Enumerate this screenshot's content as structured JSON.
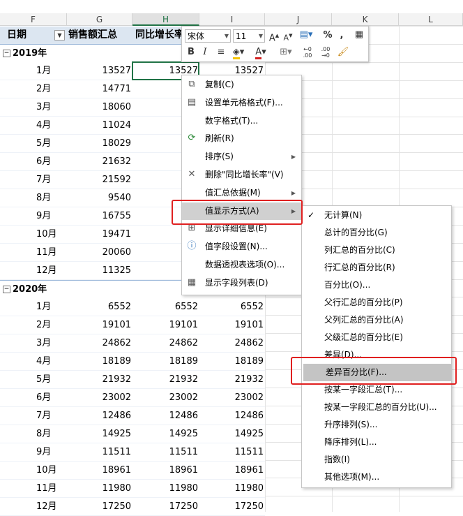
{
  "columns": [
    "F",
    "G",
    "H",
    "I",
    "J",
    "K",
    "L"
  ],
  "header": {
    "date": "日期",
    "sales": "销售额汇总",
    "growth": "同比增长率"
  },
  "years": [
    {
      "label": "2019年",
      "rows": [
        {
          "m": "1月",
          "g": "13527",
          "h": "13527",
          "i": "13527"
        },
        {
          "m": "2月",
          "g": "14771",
          "h": "14",
          "i": ""
        },
        {
          "m": "3月",
          "g": "18060",
          "h": "18",
          "i": ""
        },
        {
          "m": "4月",
          "g": "11024",
          "h": "11",
          "i": ""
        },
        {
          "m": "5月",
          "g": "18029",
          "h": "18",
          "i": ""
        },
        {
          "m": "6月",
          "g": "21632",
          "h": "21",
          "i": ""
        },
        {
          "m": "7月",
          "g": "21592",
          "h": "21",
          "i": ""
        },
        {
          "m": "8月",
          "g": "9540",
          "h": "9",
          "i": ""
        },
        {
          "m": "9月",
          "g": "16755",
          "h": "16",
          "i": ""
        },
        {
          "m": "10月",
          "g": "19471",
          "h": "19",
          "i": ""
        },
        {
          "m": "11月",
          "g": "20060",
          "h": "20",
          "i": ""
        },
        {
          "m": "12月",
          "g": "11325",
          "h": "11",
          "i": ""
        }
      ]
    },
    {
      "label": "2020年",
      "rows": [
        {
          "m": "1月",
          "g": "6552",
          "h": "6552",
          "i": "6552"
        },
        {
          "m": "2月",
          "g": "19101",
          "h": "19101",
          "i": "19101"
        },
        {
          "m": "3月",
          "g": "24862",
          "h": "24862",
          "i": "24862"
        },
        {
          "m": "4月",
          "g": "18189",
          "h": "18189",
          "i": "18189"
        },
        {
          "m": "5月",
          "g": "21932",
          "h": "21932",
          "i": "21932"
        },
        {
          "m": "6月",
          "g": "23002",
          "h": "23002",
          "i": "23002"
        },
        {
          "m": "7月",
          "g": "12486",
          "h": "12486",
          "i": "12486"
        },
        {
          "m": "8月",
          "g": "14925",
          "h": "14925",
          "i": "14925"
        },
        {
          "m": "9月",
          "g": "11511",
          "h": "11511",
          "i": "11511"
        },
        {
          "m": "10月",
          "g": "18961",
          "h": "18961",
          "i": "18961"
        },
        {
          "m": "11月",
          "g": "11980",
          "h": "11980",
          "i": "11980"
        },
        {
          "m": "12月",
          "g": "17250",
          "h": "17250",
          "i": "17250"
        }
      ]
    }
  ],
  "minitoolbar": {
    "font": "宋体",
    "size": "11"
  },
  "context_menu": [
    {
      "label": "复制(C)",
      "icon": "copy-icon"
    },
    {
      "label": "设置单元格格式(F)...",
      "icon": "format-cells-icon"
    },
    {
      "label": "数字格式(T)...",
      "icon": ""
    },
    {
      "label": "刷新(R)",
      "icon": "refresh-icon"
    },
    {
      "label": "排序(S)",
      "icon": "",
      "sub": true
    },
    {
      "label": "删除\"同比增长率\"(V)",
      "icon": "delete-icon"
    },
    {
      "label": "值汇总依据(M)",
      "icon": "",
      "sub": true
    },
    {
      "label": "值显示方式(A)",
      "icon": "",
      "sub": true,
      "highlight": true
    },
    {
      "label": "显示详细信息(E)",
      "icon": "show-details-icon"
    },
    {
      "label": "值字段设置(N)...",
      "icon": "field-settings-icon"
    },
    {
      "label": "数据透视表选项(O)...",
      "icon": ""
    },
    {
      "label": "显示字段列表(D)",
      "icon": "field-list-icon"
    }
  ],
  "show_values_as_menu": [
    {
      "label": "无计算(N)",
      "checked": true
    },
    {
      "label": "总计的百分比(G)"
    },
    {
      "label": "列汇总的百分比(C)"
    },
    {
      "label": "行汇总的百分比(R)"
    },
    {
      "label": "百分比(O)..."
    },
    {
      "label": "父行汇总的百分比(P)"
    },
    {
      "label": "父列汇总的百分比(A)"
    },
    {
      "label": "父级汇总的百分比(E)"
    },
    {
      "label": "差异(D)..."
    },
    {
      "label": "差异百分比(F)...",
      "highlight": true
    },
    {
      "label": "按某一字段汇总(T)..."
    },
    {
      "label": "按某一字段汇总的百分比(U)..."
    },
    {
      "label": "升序排列(S)..."
    },
    {
      "label": "降序排列(L)..."
    },
    {
      "label": "指数(I)"
    },
    {
      "label": "其他选项(M)..."
    }
  ]
}
